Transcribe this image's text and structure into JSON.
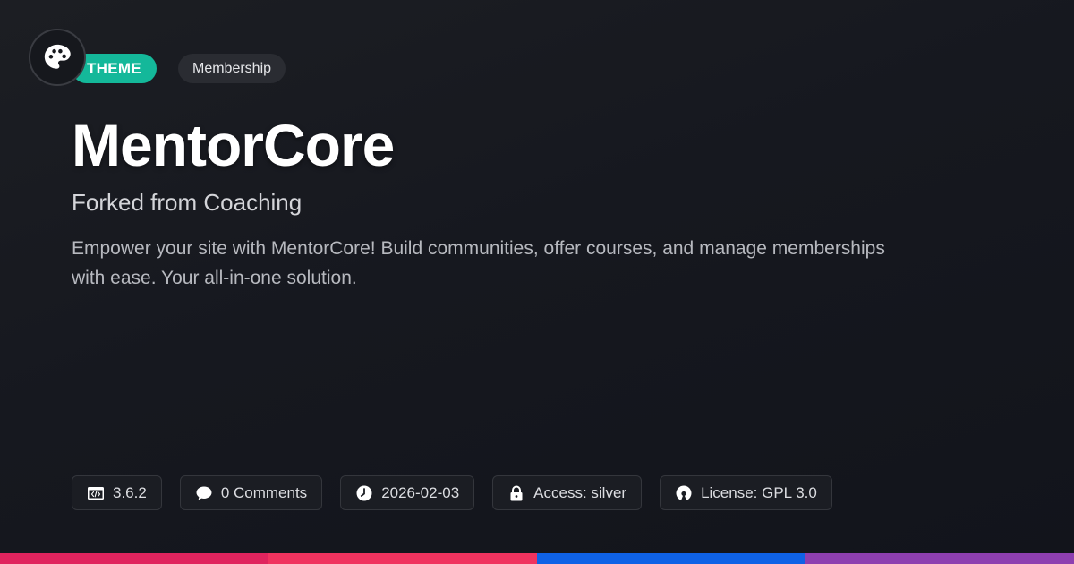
{
  "header": {
    "logo_icon": "palette-icon",
    "badge_type": "THEME",
    "badge_category": "Membership"
  },
  "product": {
    "title": "MentorCore",
    "subtitle": "Forked from Coaching",
    "description": "Empower your site with MentorCore! Build communities, offer courses, and manage memberships with ease. Your all-in-one solution."
  },
  "meta": {
    "version": "3.6.2",
    "comments": "0 Comments",
    "date": "2026-02-03",
    "access": "Access: silver",
    "license": "License: GPL 3.0"
  },
  "colors": {
    "theme_badge": "#14b89a",
    "bar_segments": [
      "#e0245e",
      "#f0335f",
      "#0f62e6",
      "#8e3fb0"
    ]
  }
}
